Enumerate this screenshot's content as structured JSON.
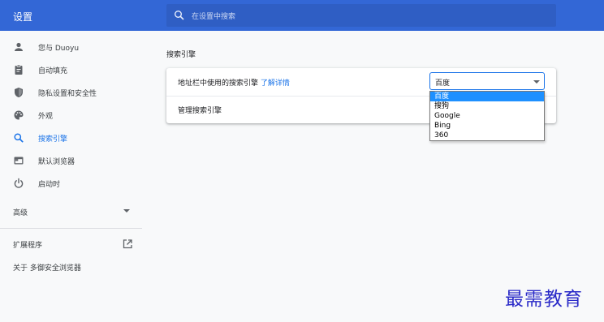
{
  "app": {
    "title": "设置"
  },
  "search": {
    "placeholder": "在设置中搜索"
  },
  "sidebar": {
    "items": [
      {
        "label": "您与 Duoyu",
        "icon": "person-icon"
      },
      {
        "label": "自动填充",
        "icon": "clipboard-icon"
      },
      {
        "label": "隐私设置和安全性",
        "icon": "shield-icon"
      },
      {
        "label": "外观",
        "icon": "palette-icon"
      },
      {
        "label": "搜索引擎",
        "icon": "search-icon",
        "active": true
      },
      {
        "label": "默认浏览器",
        "icon": "browser-icon"
      },
      {
        "label": "启动时",
        "icon": "power-icon"
      }
    ],
    "advanced_label": "高级",
    "extensions_label": "扩展程序",
    "about_label": "关于 多御安全浏览器"
  },
  "main": {
    "section_title": "搜索引擎",
    "address_bar_label": "地址栏中使用的搜索引擎",
    "learn_more_link": "了解详情",
    "manage_label": "管理搜索引擎",
    "selected_engine": "百度",
    "options": [
      "百度",
      "搜狗",
      "Google",
      "Bing",
      "360"
    ]
  },
  "watermark": "最需教育",
  "colors": {
    "header": "#3367d6",
    "accent": "#1a73e8",
    "highlight": "#1e90ff"
  }
}
